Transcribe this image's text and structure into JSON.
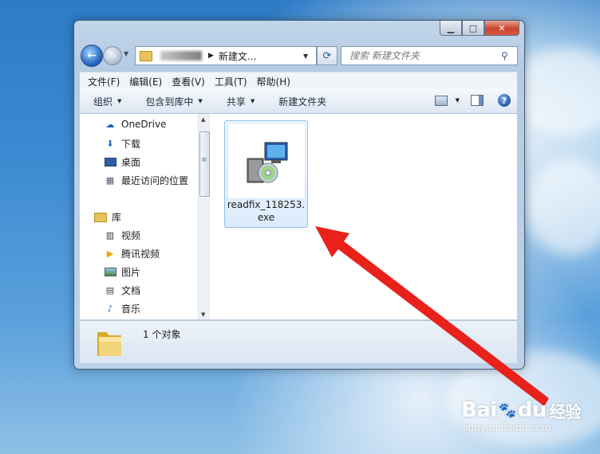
{
  "window": {
    "address": {
      "path": "新建文..."
    },
    "search": {
      "placeholder": "搜索 新建文件夹"
    },
    "menu": [
      "文件(F)",
      "编辑(E)",
      "查看(V)",
      "工具(T)",
      "帮助(H)"
    ],
    "toolbar": {
      "organize": "组织",
      "include_in_library": "包含到库中",
      "share": "共享",
      "new_folder": "新建文件夹"
    },
    "sidebar": {
      "items": [
        {
          "label": "OneDrive",
          "icon": "onedrive-icon"
        },
        {
          "label": "下载",
          "icon": "downloads-folder-icon"
        },
        {
          "label": "桌面",
          "icon": "desktop-icon"
        },
        {
          "label": "最近访问的位置",
          "icon": "recent-places-icon"
        },
        {
          "label": "库",
          "icon": "library-icon"
        },
        {
          "label": "视频",
          "icon": "video-icon"
        },
        {
          "label": "腾讯视频",
          "icon": "tencent-video-icon"
        },
        {
          "label": "图片",
          "icon": "pictures-icon"
        },
        {
          "label": "文档",
          "icon": "documents-icon"
        },
        {
          "label": "音乐",
          "icon": "music-icon"
        }
      ]
    },
    "files": [
      {
        "name": "readfix_118253.exe",
        "icon": "installer-icon"
      }
    ],
    "status": {
      "text": "1 个对象"
    }
  },
  "watermark": {
    "brand": "Bai",
    "brand2": "du",
    "cn": "经验",
    "url": "jingyan.baidu.com"
  },
  "colors": {
    "arrow": "#e8211b",
    "accent": "#1d5fb8"
  }
}
